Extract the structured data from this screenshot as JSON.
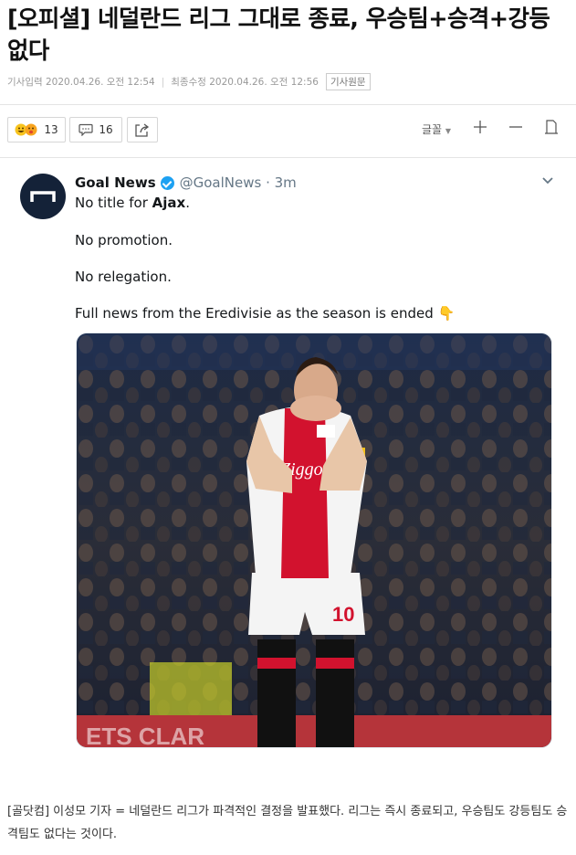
{
  "article": {
    "headline": "[오피셜] 네덜란드 리그 그대로 종료, 우승팀+승격+강등 없다",
    "input_label": "기사입력",
    "input_time": "2020.04.26. 오전 12:54",
    "modified_label": "최종수정",
    "modified_time": "2020.04.26. 오전 12:56",
    "original_button": "기사원문",
    "body": "[골닷컴] 이성모 기자 = 네덜란드 리그가 파격적인 결정을 발표했다. 리그는 즉시 종료되고, 우승팀도 강등팀도 승격팀도 없다는 것이다."
  },
  "toolbar": {
    "reaction_count": "13",
    "comment_count": "16",
    "font_label": "글꼴"
  },
  "tweet": {
    "name": "Goal News",
    "handle": "@GoalNews · 3m",
    "line1_prefix": "No title for ",
    "line1_bold": "Ajax",
    "line1_suffix": ".",
    "line2": "No promotion.",
    "line3": "No relegation.",
    "line4": "Full news from the Eredivisie as the season is ended",
    "line4_emoji": "👇",
    "jersey_sponsor": "Ziggo",
    "jersey_number": "10"
  },
  "colors": {
    "verified": "#1da1f2",
    "avatar": "#142238",
    "jersey_red": "#d2122e"
  }
}
